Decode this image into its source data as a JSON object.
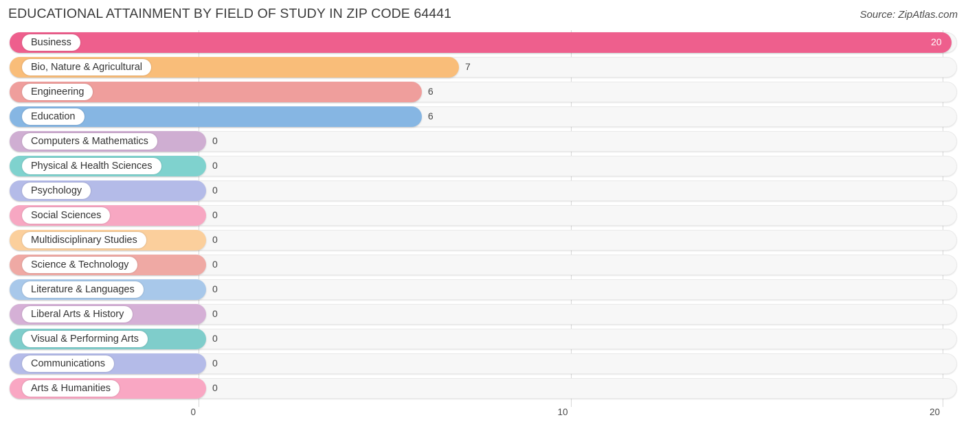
{
  "header": {
    "title": "EDUCATIONAL ATTAINMENT BY FIELD OF STUDY IN ZIP CODE 64441",
    "source": "Source: ZipAtlas.com"
  },
  "chart_data": {
    "type": "bar",
    "orientation": "horizontal",
    "title": "EDUCATIONAL ATTAINMENT BY FIELD OF STUDY IN ZIP CODE 64441",
    "subtitle": "Source: ZipAtlas.com",
    "xlabel": "",
    "ylabel": "",
    "xlim": [
      0,
      20
    ],
    "xticks": [
      0,
      10,
      20
    ],
    "xtick_labels": [
      "0",
      "10",
      "20"
    ],
    "grid": true,
    "legend": false,
    "categories": [
      "Business",
      "Bio, Nature & Agricultural",
      "Engineering",
      "Education",
      "Computers & Mathematics",
      "Physical & Health Sciences",
      "Psychology",
      "Social Sciences",
      "Multidisciplinary Studies",
      "Science & Technology",
      "Literature & Languages",
      "Liberal Arts & History",
      "Visual & Performing Arts",
      "Communications",
      "Arts & Humanities"
    ],
    "values": [
      20,
      7,
      6,
      6,
      0,
      0,
      0,
      0,
      0,
      0,
      0,
      0,
      0,
      0,
      0
    ],
    "value_labels": [
      "20",
      "7",
      "6",
      "6",
      "0",
      "0",
      "0",
      "0",
      "0",
      "0",
      "0",
      "0",
      "0",
      "0",
      "0"
    ],
    "colors": [
      "#ee5f8d",
      "#f9bd79",
      "#ef9e9c",
      "#86b6e3",
      "#cfaed2",
      "#7fd2ce",
      "#b4bbe8",
      "#f7a7c2",
      "#fbcf9c",
      "#efa9a4",
      "#a8c8ea",
      "#d5b0d6",
      "#7fcdcb",
      "#b4bbe8",
      "#f9a7c3"
    ]
  }
}
